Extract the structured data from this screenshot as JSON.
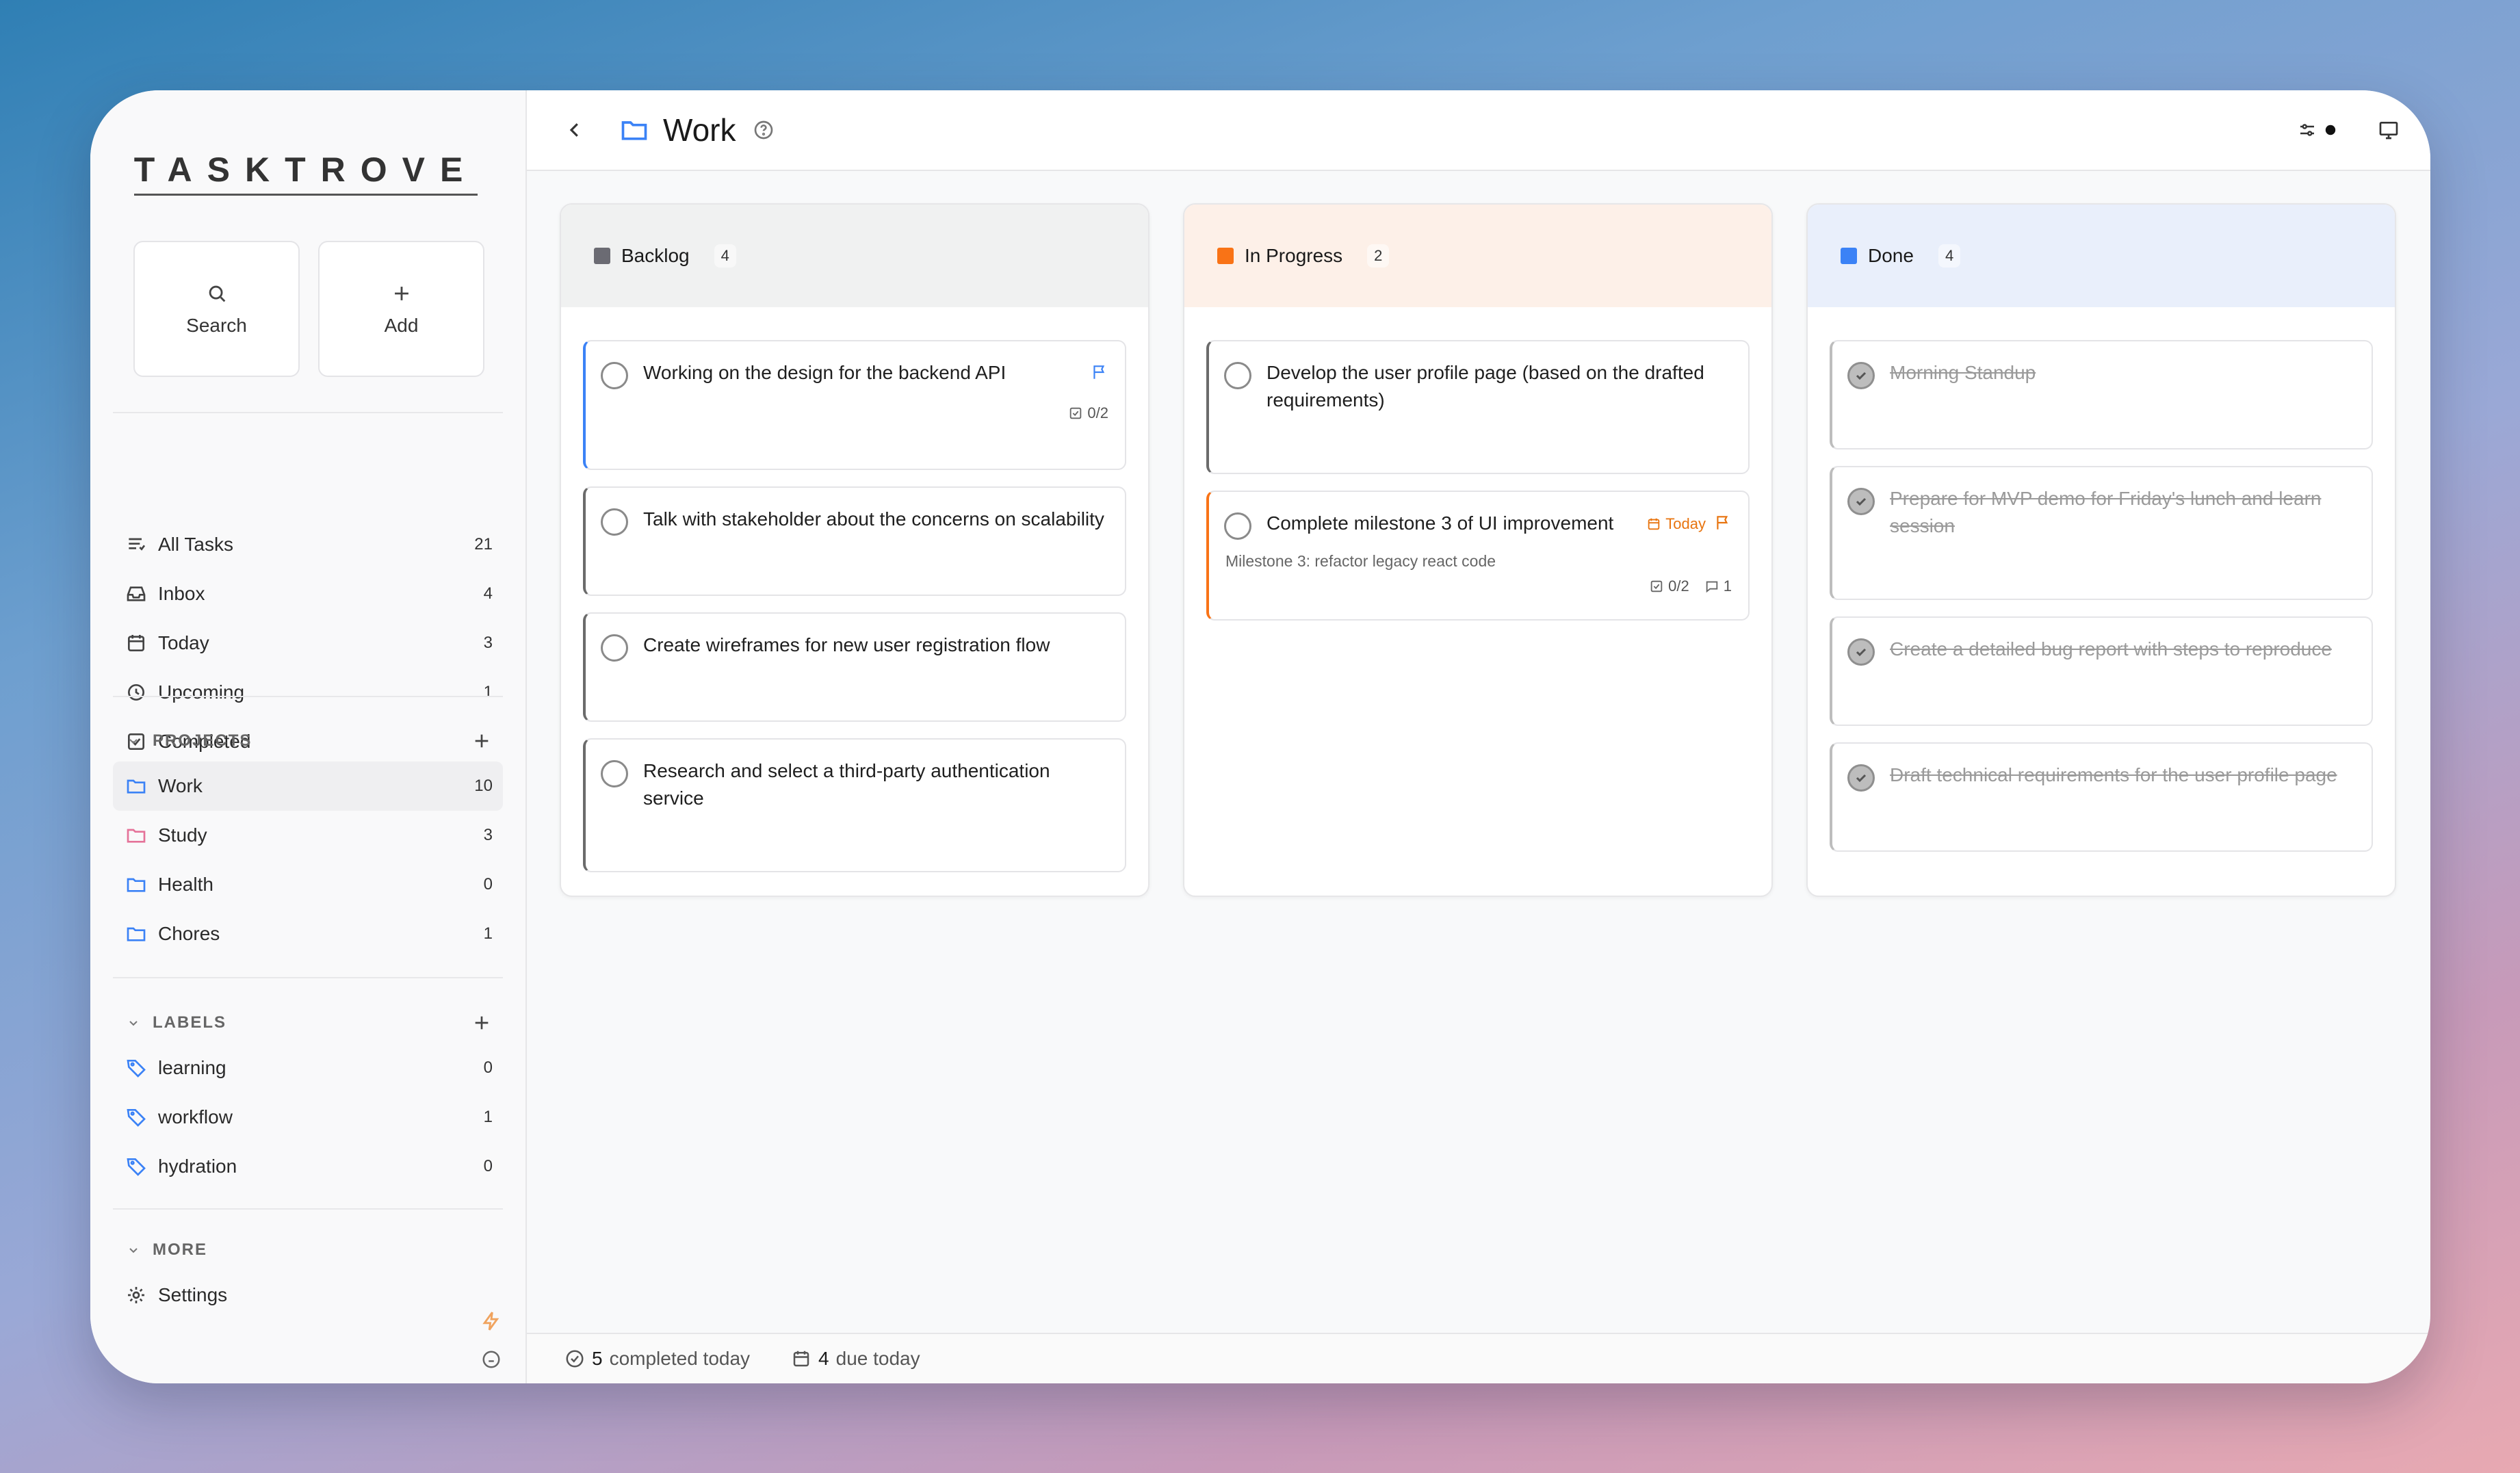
{
  "app": {
    "logo": "TASKTROVE"
  },
  "quick_actions": {
    "search": "Search",
    "add": "Add"
  },
  "nav": [
    {
      "label": "All Tasks",
      "count": "21",
      "icon": "list-icon"
    },
    {
      "label": "Inbox",
      "count": "4",
      "icon": "inbox-icon"
    },
    {
      "label": "Today",
      "count": "3",
      "icon": "calendar-icon"
    },
    {
      "label": "Upcoming",
      "count": "1",
      "icon": "clock-icon"
    },
    {
      "label": "Completed",
      "count": "",
      "icon": "check-square-icon"
    }
  ],
  "projects": {
    "header": "PROJECTS",
    "items": [
      {
        "label": "Work",
        "count": "10",
        "color": "#3b82f6"
      },
      {
        "label": "Study",
        "count": "3",
        "color": "#e57399"
      },
      {
        "label": "Health",
        "count": "0",
        "color": "#3b82f6"
      },
      {
        "label": "Chores",
        "count": "1",
        "color": "#3b82f6"
      }
    ]
  },
  "labels": {
    "header": "LABELS",
    "items": [
      {
        "label": "learning",
        "count": "0"
      },
      {
        "label": "workflow",
        "count": "1"
      },
      {
        "label": "hydration",
        "count": "0"
      }
    ]
  },
  "more": {
    "header": "MORE",
    "settings": "Settings"
  },
  "header": {
    "title": "Work"
  },
  "columns": [
    {
      "name": "Backlog",
      "count": "4",
      "color": "#6b6b73",
      "bg": "#f0f1f1",
      "cards": [
        {
          "title": "Working on the design for the backend API",
          "subtasks": "0/2"
        },
        {
          "title": "Talk with stakeholder about the concerns on scalability"
        },
        {
          "title": "Create wireframes for new user registration flow"
        },
        {
          "title": "Research and select a third-party authentication service"
        }
      ]
    },
    {
      "name": "In Progress",
      "count": "2",
      "color": "#f97316",
      "bg": "#fdf0e8",
      "cards": [
        {
          "title": "Develop the user profile page (based on the drafted requirements)"
        },
        {
          "title": "Complete milestone 3 of UI improvement",
          "due": "Today",
          "description": "Milestone 3: refactor legacy react code",
          "subtasks": "0/2",
          "comments": "1"
        }
      ]
    },
    {
      "name": "Done",
      "count": "4",
      "color": "#3b82f6",
      "bg": "#e9effb",
      "cards": [
        {
          "title": "Morning Standup"
        },
        {
          "title": "Prepare for MVP demo for Friday's lunch and learn session"
        },
        {
          "title": "Create a detailed bug report with steps to reproduce"
        },
        {
          "title": "Draft technical requirements for the user profile page"
        }
      ]
    }
  ],
  "status": {
    "completed_num": "5",
    "completed_text": "completed today",
    "due_num": "4",
    "due_text": "due today"
  }
}
